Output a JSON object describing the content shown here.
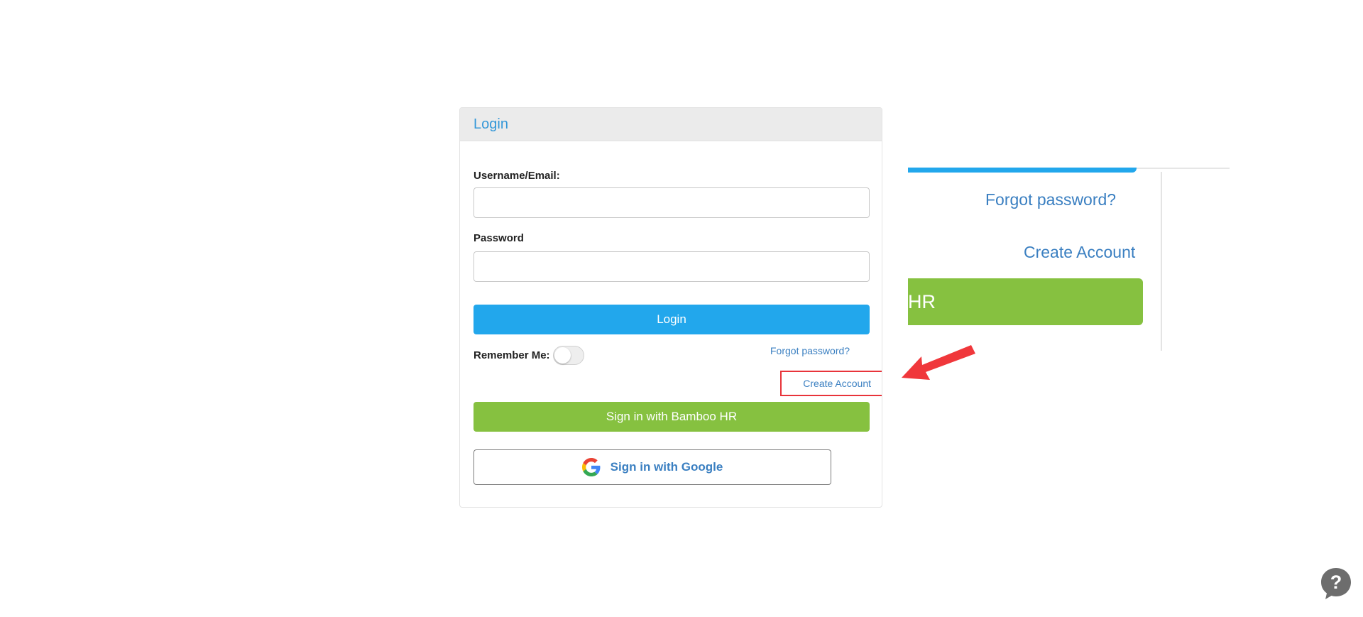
{
  "login_card": {
    "title": "Login",
    "username_label": "Username/Email:",
    "username_value": "",
    "password_label": "Password",
    "password_value": "",
    "login_button": "Login",
    "remember_label": "Remember Me:",
    "remember_on": false,
    "forgot_link": "Forgot password?",
    "create_account_link": "Create Account",
    "bamboo_button": "Sign in with Bamboo HR",
    "google_button": "Sign in with Google"
  },
  "zoom_callout": {
    "forgot_text": "Forgot password?",
    "create_text": "Create Account",
    "bamboo_fragment": "HR"
  },
  "icons": {
    "toggle": "toggle-switch-icon",
    "google": "google-logo-icon",
    "arrow": "red-arrow-icon",
    "help": "question-bubble-icon"
  },
  "colors": {
    "primary_blue": "#22a7ec",
    "bamboo_green": "#86c140",
    "link_blue": "#3a7fc1",
    "highlight_red": "#e8333a",
    "help_gray": "#6d6d6d"
  }
}
